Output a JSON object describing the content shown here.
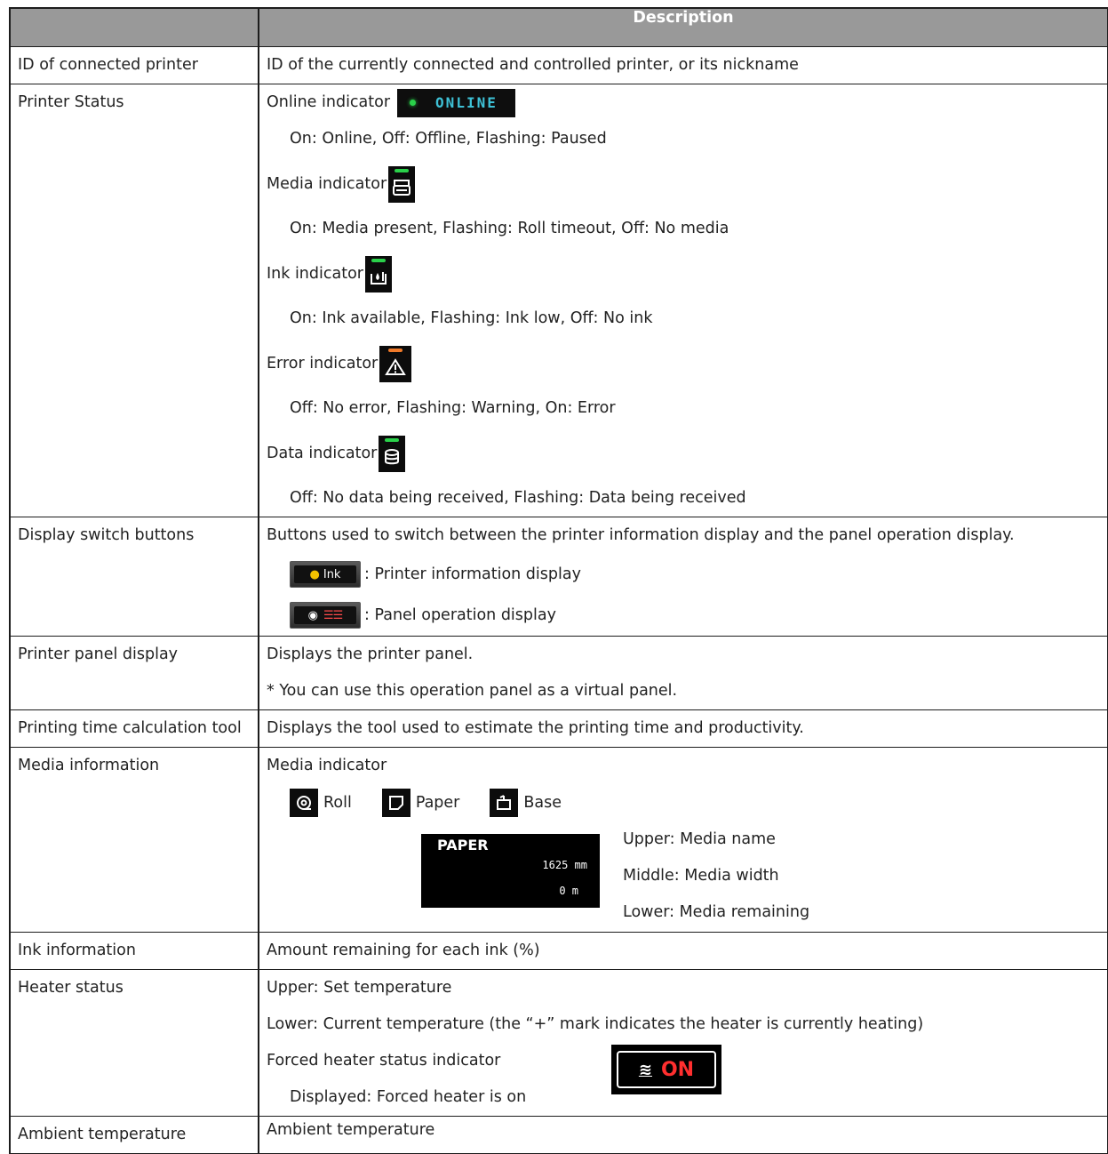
{
  "header": {
    "col1": "",
    "col2": "Description"
  },
  "rows": {
    "connected_id": {
      "label": "ID of connected printer",
      "desc": "ID of the currently connected and controlled printer, or its nickname"
    },
    "printer_status": {
      "label": "Printer Status",
      "online_label": "Online indicator",
      "online_badge": "ONLINE",
      "online_states": "On: Online, Off: Offline, Flashing: Paused",
      "media_label": "Media indicator",
      "media_states": "On: Media present, Flashing: Roll timeout, Off: No media",
      "ink_label": "Ink indicator",
      "ink_states": "On: Ink available, Flashing: Ink low, Off: No ink",
      "error_label": "Error indicator",
      "error_states": "Off: No error, Flashing: Warning, On: Error",
      "data_label": "Data indicator",
      "data_states": "Off: No data being received, Flashing: Data being received",
      "indicator_colors": {
        "green": "#2ad14a",
        "orange": "#f07a2a",
        "cyan": "#3ec1d6"
      }
    },
    "display_switch": {
      "label": "Display switch buttons",
      "desc": "Buttons used to switch between the printer information display and the panel operation display.",
      "btn1_text": "Ink",
      "btn1_desc": ": Printer information display",
      "btn2_desc": ": Panel operation display"
    },
    "panel_display": {
      "label": "Printer panel display",
      "desc": "Displays the printer panel.",
      "note": "* You can use this operation panel as a virtual panel."
    },
    "time_tool": {
      "label": "Printing time calculation tool",
      "desc": "Displays the tool used to estimate the printing time and productivity."
    },
    "media_info": {
      "label": "Media information",
      "indicator_label": "Media indicator",
      "roll": "Roll",
      "paper": "Paper",
      "base": "Base",
      "disp_name": "PAPER",
      "disp_width": "1625  mm",
      "disp_remaining": "0  m",
      "upper": "Upper: Media name",
      "middle": "Middle: Media width",
      "lower": "Lower: Media remaining"
    },
    "ink_info": {
      "label": "Ink information",
      "desc": "Amount remaining for each ink (%)"
    },
    "heater": {
      "label": "Heater status",
      "upper": "Upper: Set temperature",
      "lower": "Lower: Current temperature (the “+” mark indicates the heater is currently heating)",
      "forced_label": "Forced heater status indicator",
      "forced_desc": "Displayed: Forced heater is on",
      "badge_on": "ON",
      "badge_icon": "≋"
    },
    "ambient": {
      "label": "Ambient temperature",
      "desc": "Ambient temperature"
    }
  }
}
